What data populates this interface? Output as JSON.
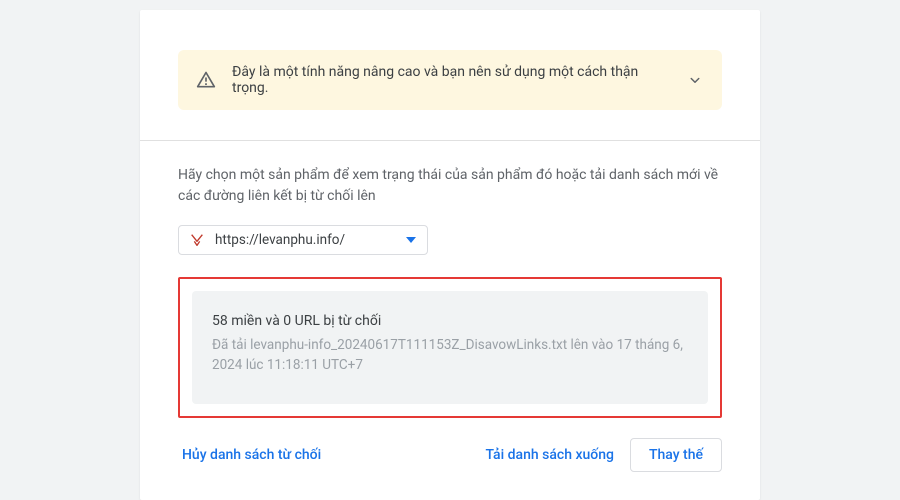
{
  "warning": {
    "text": "Đây là một tính năng nâng cao và bạn nên sử dụng một cách thận trọng."
  },
  "instruction": "Hãy chọn một sản phẩm để xem trạng thái của sản phẩm đó hoặc tải danh sách mới về các đường liên kết bị từ chối lên",
  "selector": {
    "site": "https://levanphu.info/"
  },
  "status": {
    "title": "58 miền và 0 URL bị từ chối",
    "subtitle": "Đã tải levanphu-info_20240617T111153Z_DisavowLinks.txt lên vào 17 tháng 6, 2024 lúc 11:18:11 UTC+7"
  },
  "actions": {
    "cancel": "Hủy danh sách từ chối",
    "download": "Tải danh sách xuống",
    "replace": "Thay thế"
  }
}
